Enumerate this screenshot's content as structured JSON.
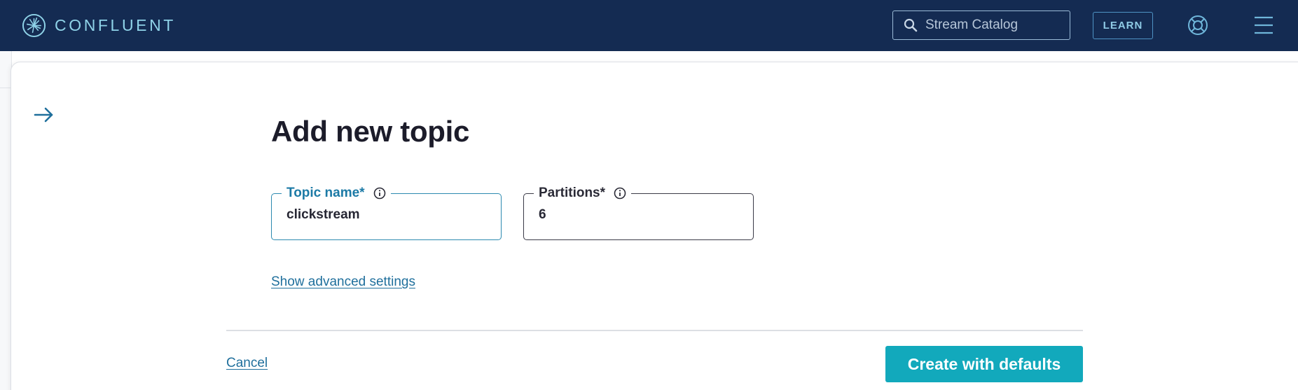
{
  "topbar": {
    "brand_name": "CONFLUENT",
    "search_placeholder": "Stream Catalog",
    "learn_label": "LEARN"
  },
  "panel": {
    "title": "Add new topic",
    "topic_field": {
      "label": "Topic name*",
      "value": "clickstream"
    },
    "partitions_field": {
      "label": "Partitions*",
      "value": "6"
    },
    "advanced_link": "Show advanced settings",
    "cancel_label": "Cancel",
    "create_label": "Create with defaults"
  },
  "colors": {
    "topbar_bg": "#142b52",
    "brand_accent": "#8fd3e8",
    "primary_button": "#12a9bc",
    "link": "#1f6f9c",
    "focused_field": "#2c8ab0"
  },
  "icons": {
    "brand": "confluent-burst-icon",
    "search": "search-icon",
    "help": "lifebuoy-icon",
    "menu": "hamburger-menu-icon",
    "collapse": "arrow-right-icon",
    "field_info": "info-icon"
  }
}
